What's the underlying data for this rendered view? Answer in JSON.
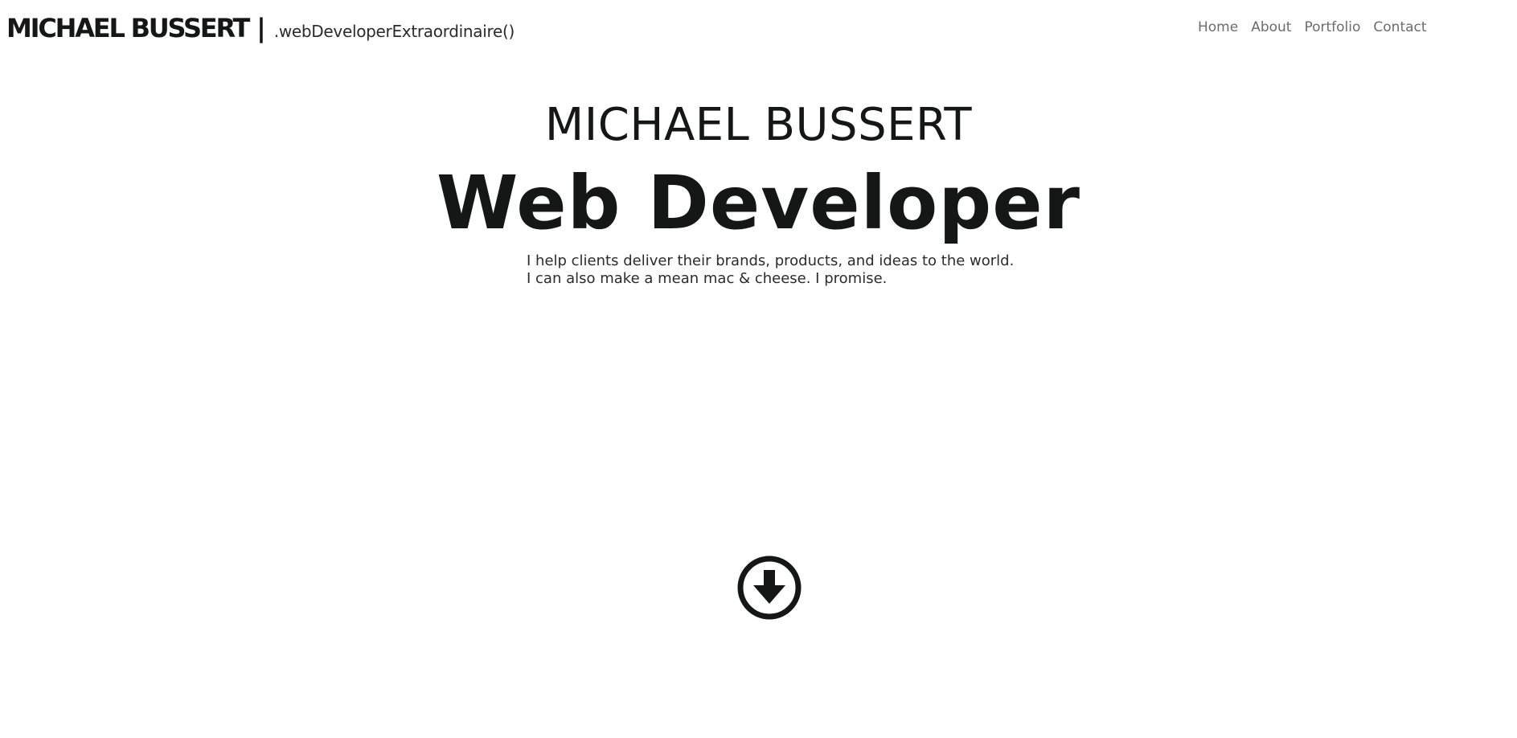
{
  "header": {
    "brand_name": "MICHAEL BUSSERT",
    "separator": "|",
    "tagline": ".webDeveloperExtraordinaire()"
  },
  "nav": {
    "items": [
      {
        "label": "Home"
      },
      {
        "label": "About"
      },
      {
        "label": "Portfolio"
      },
      {
        "label": "Contact"
      }
    ]
  },
  "hero": {
    "name": "MICHAEL BUSSERT",
    "title": "Web Developer",
    "copy_line_1": "I help clients deliver their brands, products, and ideas to the world.",
    "copy_line_2": "I can also make a mean mac & cheese. I promise."
  },
  "scroll_button": {
    "icon": "arrow-circle-down-icon"
  },
  "colors": {
    "text_primary": "#151717",
    "nav_text": "#6c6c6c",
    "background": "#ffffff"
  }
}
